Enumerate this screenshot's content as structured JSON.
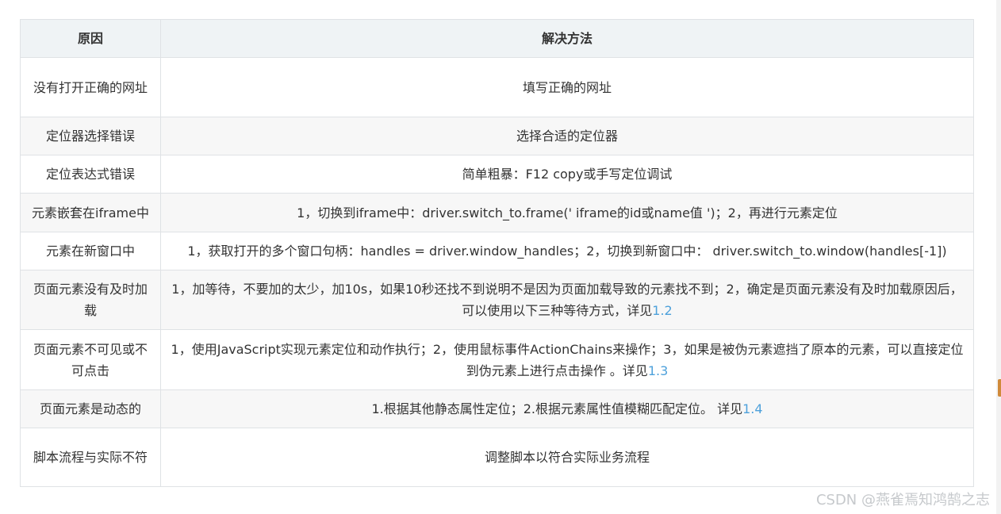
{
  "table": {
    "headers": [
      "原因",
      "解决方法"
    ],
    "rows": [
      {
        "cause": "没有打开正确的网址",
        "solution": "填写正确的网址",
        "ref": ""
      },
      {
        "cause": "定位器选择错误",
        "solution": "选择合适的定位器",
        "ref": ""
      },
      {
        "cause": "定位表达式错误",
        "solution": "简单粗暴：F12 copy或手写定位调试",
        "ref": ""
      },
      {
        "cause": "元素嵌套在iframe中",
        "solution": "1，切换到iframe中：driver.switch_to.frame(' iframe的id或name值 ')；2，再进行元素定位",
        "ref": ""
      },
      {
        "cause": "元素在新窗口中",
        "solution": "1，获取打开的多个窗口句柄：handles = driver.window_handles；2，切换到新窗口中： driver.switch_to.window(handles[-1])",
        "ref": ""
      },
      {
        "cause": "页面元素没有及时加载",
        "solution": "1，加等待，不要加的太少，加10s，如果10秒还找不到说明不是因为页面加载导致的元素找不到；2，确定是页面元素没有及时加载原因后，可以使用以下三种等待方式，详见",
        "ref": "1.2"
      },
      {
        "cause": "页面元素不可见或不可点击",
        "solution": "1，使用JavaScript实现元素定位和动作执行；2，使用鼠标事件ActionChains来操作；3，如果是被伪元素遮挡了原本的元素，可以直接定位到伪元素上进行点击操作 。详见",
        "ref": "1.3"
      },
      {
        "cause": "页面元素是动态的",
        "solution": "1.根据其他静态属性定位；2.根据元素属性值模糊匹配定位。 详见",
        "ref": "1.4"
      },
      {
        "cause": "脚本流程与实际不符",
        "solution": "调整脚本以符合实际业务流程",
        "ref": ""
      }
    ]
  },
  "watermark": "CSDN @燕雀焉知鸿鹄之志",
  "colors": {
    "link": "#4ea1db",
    "header_bg": "#eff3f5",
    "stripe_bg": "#f7f7f7",
    "border": "#dfe2e5"
  }
}
